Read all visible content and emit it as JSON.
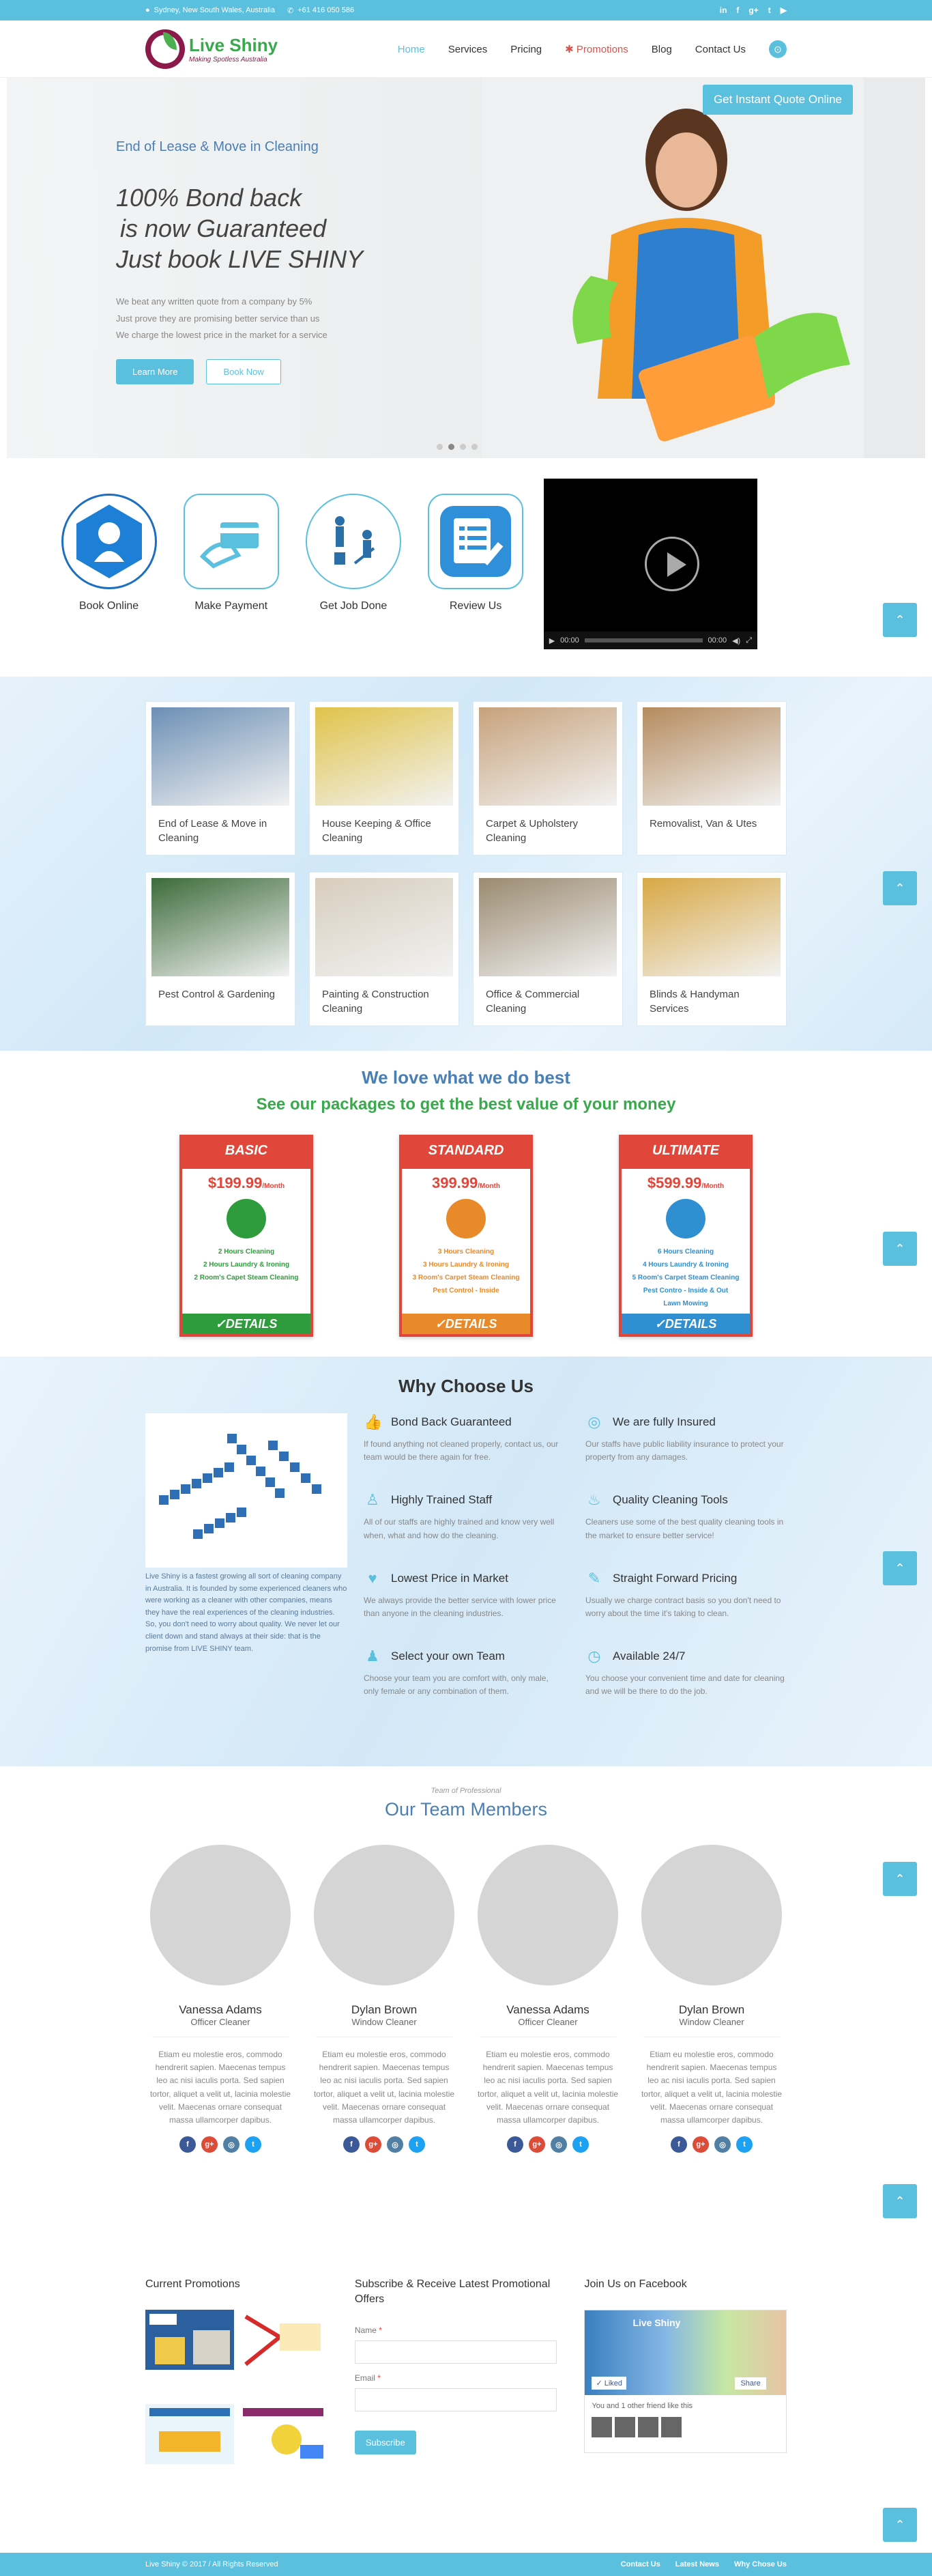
{
  "topbar": {
    "address": "Sydney, New South Wales, Australia",
    "phone": "+61 416 050 586",
    "social": [
      "in",
      "f",
      "g+",
      "t",
      "▶"
    ]
  },
  "brand": {
    "name": "Live Shiny",
    "tagline": "Making Spotless Australia"
  },
  "nav": [
    {
      "label": "Home",
      "state": "active"
    },
    {
      "label": "Services",
      "state": ""
    },
    {
      "label": "Pricing",
      "state": ""
    },
    {
      "label": "Promotions",
      "state": "promo"
    },
    {
      "label": "Blog",
      "state": ""
    },
    {
      "label": "Contact Us",
      "state": ""
    }
  ],
  "hero": {
    "quote_button": "Get Instant Quote Online",
    "subtitle": "End of Lease & Move in Cleaning",
    "title_line1": "100% Bond back",
    "title_line2": "is now Guaranteed",
    "title_line3": "Just book LIVE SHINY",
    "desc_line1": "We beat any written quote from a company by 5%",
    "desc_line2": "Just prove they are promising better service than us",
    "desc_line3": "We charge the lowest price in the market for a service",
    "btn_learn": "Learn More",
    "btn_book": "Book Now"
  },
  "steps": [
    {
      "label": "Book Online",
      "icon": "maid-icon"
    },
    {
      "label": "Make Payment",
      "icon": "card-payment-icon"
    },
    {
      "label": "Get Job Done",
      "icon": "cleaners-icon"
    },
    {
      "label": "Review Us",
      "icon": "review-form-icon"
    }
  ],
  "video": {
    "time_current": "00:00",
    "time_total": "00:00"
  },
  "services": [
    {
      "title": "End of Lease & Move in Cleaning",
      "color": "#6c8fb5"
    },
    {
      "title": "House Keeping & Office Cleaning",
      "color": "#e0c34a"
    },
    {
      "title": "Carpet & Upholstery Cleaning",
      "color": "#c7a27c"
    },
    {
      "title": "Removalist, Van & Utes",
      "color": "#b58b5e"
    },
    {
      "title": "Pest Control & Gardening",
      "color": "#3c6b3a"
    },
    {
      "title": "Painting & Construction Cleaning",
      "color": "#d7cdbd"
    },
    {
      "title": "Office & Commercial Cleaning",
      "color": "#9a8a70"
    },
    {
      "title": "Blinds & Handyman Services",
      "color": "#d8a845"
    }
  ],
  "packages_section": {
    "heading": "We love what we do best",
    "subheading": "See our packages to get the best value of your money"
  },
  "packages": [
    {
      "name": "BASIC",
      "price": "$199.99",
      "per": "/Month",
      "accent": "#e0473a",
      "btn_color": "#2e9c3c",
      "feat_color": "#2e9c3c",
      "features": [
        "2 Hours Cleaning",
        "2 Hours Laundry & Ironing",
        "2 Room's Capet Steam Cleaning"
      ],
      "button": "✓DETAILS"
    },
    {
      "name": "STANDARD",
      "price": "399.99",
      "per": "/Month",
      "accent": "#e0473a",
      "btn_color": "#e98a2a",
      "feat_color": "#e98a2a",
      "features": [
        "3 Hours Cleaning",
        "3 Hours Laundry & Ironing",
        "3 Room's Carpet Steam Cleaning",
        "Pest Control - Inside"
      ],
      "button": "✓DETAILS"
    },
    {
      "name": "ULTIMATE",
      "price": "$599.99",
      "per": "/Month",
      "accent": "#e0473a",
      "btn_color": "#2f8fd0",
      "feat_color": "#2f8fd0",
      "features": [
        "6 Hours Cleaning",
        "4 Hours Laundry & Ironing",
        "5 Room's Carpet Steam Cleaning",
        "Pest Contro - Inside & Out",
        "Lawn Mowing"
      ],
      "button": "✓DETAILS"
    }
  ],
  "why": {
    "title": "Why Choose Us",
    "about": "Live Shiny is a fastest growing all sort of cleaning company in Australia. It is founded by some experienced cleaners who were working as a cleaner with other companies, means they have the real experiences of the cleaning industries. So, you don't need to worry about quality. We never let our client down and stand always at their side: that is the promise from LIVE SHINY team.",
    "features": [
      {
        "title": "Bond Back Guaranteed",
        "text": "If found anything not cleaned properly, contact us, our team would be there again for free.",
        "icon": "thumbs-up-icon"
      },
      {
        "title": "We are fully Insured",
        "text": "Our staffs have public liability insurance to protect your property from any damages.",
        "icon": "globe-icon"
      },
      {
        "title": "Highly Trained Staff",
        "text": "All of our staffs are highly trained and know very well when, what and how do the cleaning.",
        "icon": "staff-icon"
      },
      {
        "title": "Quality Cleaning Tools",
        "text": "Cleaners use some of the best quality cleaning tools in the market to ensure better service!",
        "icon": "spray-icon"
      },
      {
        "title": "Lowest Price in Market",
        "text": "We always provide the better service with lower price than anyone in the cleaning industries.",
        "icon": "heart-icon"
      },
      {
        "title": "Straight Forward Pricing",
        "text": "Usually we charge contract basis so you don't need to worry about the time it's taking to clean.",
        "icon": "edit-icon"
      },
      {
        "title": "Select your own Team",
        "text": "Choose your team you are comfort with, only male, only female or any combination of them.",
        "icon": "team-icon"
      },
      {
        "title": "Available 24/7",
        "text": "You choose your convenient time and date for cleaning and we will be there to do the job.",
        "icon": "clock-icon"
      }
    ]
  },
  "team": {
    "small": "Team of Professional",
    "title": "Our Team Members",
    "members": [
      {
        "name": "Vanessa Adams",
        "role": "Officer Cleaner",
        "bio": "Etiam eu molestie eros, commodo hendrerit sapien. Maecenas tempus leo ac nisi iaculis porta. Sed sapien tortor, aliquet a velit ut, lacinia molestie velit. Maecenas ornare consequat massa ullamcorper dapibus."
      },
      {
        "name": "Dylan Brown",
        "role": "Window Cleaner",
        "bio": "Etiam eu molestie eros, commodo hendrerit sapien. Maecenas tempus leo ac nisi iaculis porta. Sed sapien tortor, aliquet a velit ut, lacinia molestie velit. Maecenas ornare consequat massa ullamcorper dapibus."
      },
      {
        "name": "Vanessa Adams",
        "role": "Officer Cleaner",
        "bio": "Etiam eu molestie eros, commodo hendrerit sapien. Maecenas tempus leo ac nisi iaculis porta. Sed sapien tortor, aliquet a velit ut, lacinia molestie velit. Maecenas ornare consequat massa ullamcorper dapibus."
      },
      {
        "name": "Dylan Brown",
        "role": "Window Cleaner",
        "bio": "Etiam eu molestie eros, commodo hendrerit sapien. Maecenas tempus leo ac nisi iaculis porta. Sed sapien tortor, aliquet a velit ut, lacinia molestie velit. Maecenas ornare consequat massa ullamcorper dapibus."
      }
    ],
    "social": [
      {
        "glyph": "f",
        "color": "#3b5998"
      },
      {
        "glyph": "g+",
        "color": "#dd4b39"
      },
      {
        "glyph": "◎",
        "color": "#517fa4"
      },
      {
        "glyph": "t",
        "color": "#1da1f2"
      }
    ]
  },
  "widgets": {
    "promotions_title": "Current Promotions",
    "subscribe_title": "Subscribe & Receive Latest Promotional Offers",
    "name_label": "Name",
    "email_label": "Email",
    "required_mark": "*",
    "subscribe_button": "Subscribe",
    "facebook_title": "Join Us on Facebook",
    "fb_page_name": "Live Shiny",
    "fb_liked": "Liked",
    "fb_share": "Share",
    "fb_friends": "You and 1 other friend like this"
  },
  "footer": {
    "copyright": "Live Shiny © 2017 / All Rights Reserved",
    "links": [
      "Contact Us",
      "Latest News",
      "Why Chose Us"
    ]
  }
}
